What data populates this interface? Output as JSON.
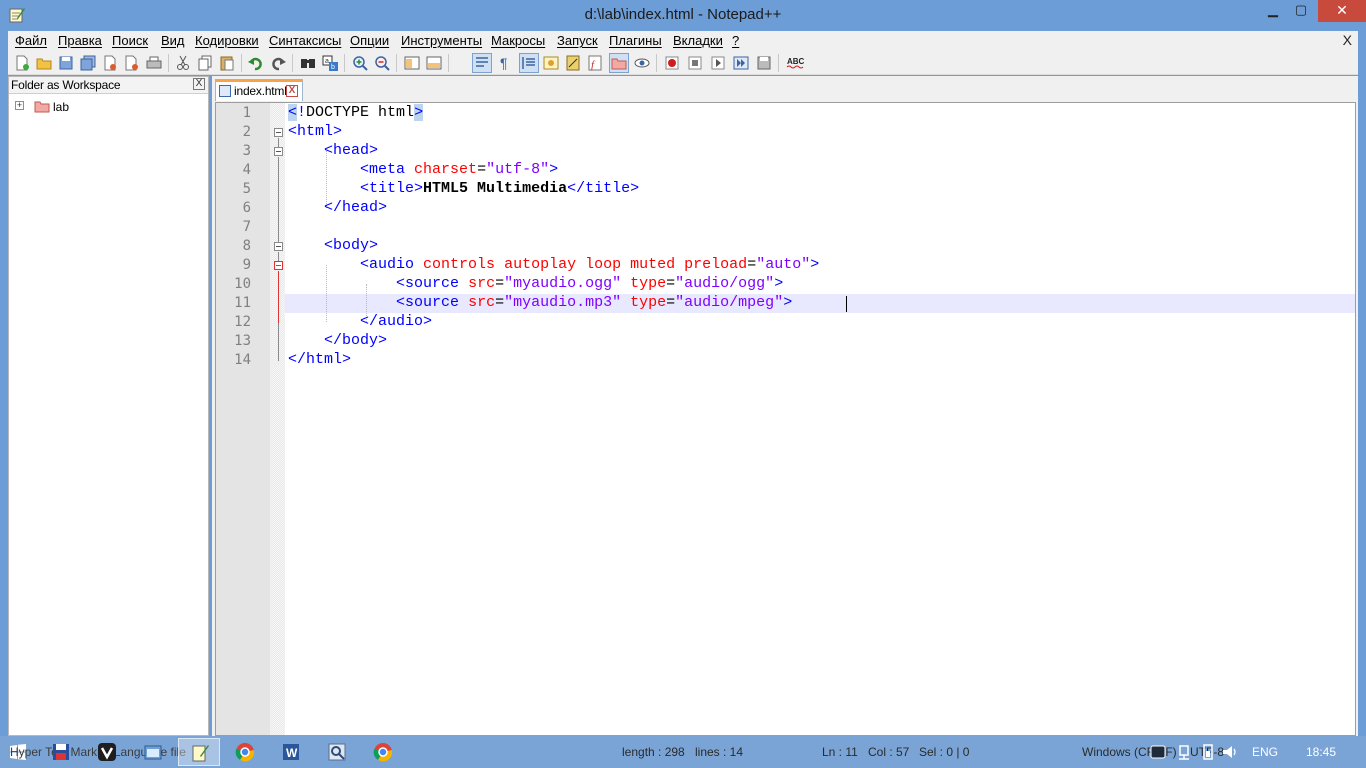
{
  "window": {
    "title": "d:\\lab\\index.html - Notepad++"
  },
  "menu": [
    "Файл",
    "Правка",
    "Поиск",
    "Вид",
    "Кодировки",
    "Синтаксисы",
    "Опции",
    "Инструменты",
    "Макросы",
    "Запуск",
    "Плагины",
    "Вкладки",
    "?"
  ],
  "menu_close": "X",
  "toolbar_icons": [
    "new-file-icon",
    "open-file-icon",
    "save-icon",
    "save-all-icon",
    "close-icon",
    "close-all-icon",
    "print-icon",
    "cut-icon",
    "copy-icon",
    "paste-icon",
    "undo-icon",
    "redo-icon",
    "find-icon",
    "replace-icon",
    "zoom-in-icon",
    "zoom-out-icon",
    "sync-vertical-icon",
    "sync-horizontal-icon",
    "word-wrap-icon",
    "show-all-chars-icon",
    "indent-guide-icon",
    "udl-icon",
    "doc-map-icon",
    "function-list-icon",
    "folder-workspace-icon",
    "monitoring-icon",
    "record-macro-icon",
    "stop-record-icon",
    "play-macro-icon",
    "run-macro-multiple-icon",
    "save-macro-icon",
    "spell-check-icon"
  ],
  "panel": {
    "title": "Folder as Workspace",
    "close": "X",
    "tree": [
      {
        "label": "lab",
        "expander": "+"
      }
    ]
  },
  "tab": {
    "label": "index.html",
    "close": "X"
  },
  "editor": {
    "current_line": 11,
    "lines": [
      {
        "n": "1",
        "text": "<!DOCTYPE html>"
      },
      {
        "n": "2",
        "text": "<html>"
      },
      {
        "n": "3",
        "text": "    <head>"
      },
      {
        "n": "4",
        "text": "        <meta charset=\"utf-8\">"
      },
      {
        "n": "5",
        "text": "        <title>HTML5 Multimedia</title>"
      },
      {
        "n": "6",
        "text": "    </head>"
      },
      {
        "n": "7",
        "text": ""
      },
      {
        "n": "8",
        "text": "    <body>"
      },
      {
        "n": "9",
        "text": "        <audio controls autoplay loop muted preload=\"auto\">"
      },
      {
        "n": "10",
        "text": "            <source src=\"myaudio.ogg\" type=\"audio/ogg\">"
      },
      {
        "n": "11",
        "text": "            <source src=\"myaudio.mp3\" type=\"audio/mpeg\">"
      },
      {
        "n": "12",
        "text": "        </audio>"
      },
      {
        "n": "13",
        "text": "    </body>"
      },
      {
        "n": "14",
        "text": "</html>"
      }
    ]
  },
  "statusbar": {
    "doc_type": "Hyper Text Markup Language file",
    "length": "length : 298",
    "lines": "lines : 14",
    "ln": "Ln : 11",
    "col": "Col : 57",
    "sel": "Sel : 0 | 0",
    "eol": "Windows (CR LF)",
    "encoding": "UTF-8"
  },
  "tray": {
    "lang": "ENG",
    "time": "18:45"
  },
  "taskbar_apps": [
    "save-icon-app",
    "vivaldi-icon",
    "explorer-icon",
    "notepadpp-icon",
    "chrome-icon",
    "word-icon",
    "search-app-icon",
    "chrome-icon-2"
  ]
}
